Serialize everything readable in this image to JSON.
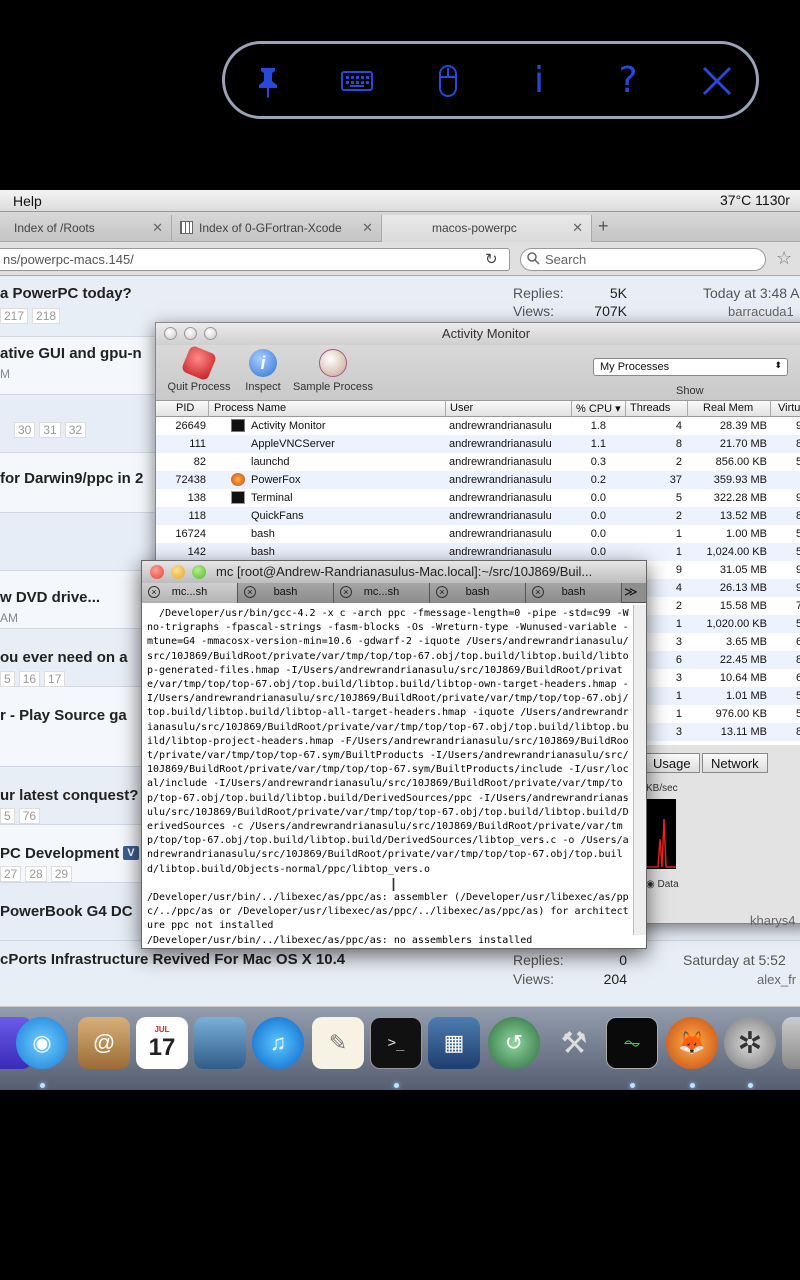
{
  "vnc_toolbar": {
    "info_label": "i",
    "help_label": "?"
  },
  "menubar": {
    "help": "Help",
    "status": "37°C 1130r"
  },
  "browser": {
    "tabs": [
      "Index of /Roots",
      "Index of 0-GFortran-Xcode",
      "macos-powerpc"
    ],
    "url": "ns/powerpc-macs.145/",
    "search_placeholder": "Search"
  },
  "forum": {
    "rows": [
      {
        "title": "a PowerPC today?",
        "pages": [
          "217",
          "218"
        ],
        "replies_label": "Replies:",
        "replies": "5K",
        "views_label": "Views:",
        "views": "707K",
        "date": "Today at 3:48 A",
        "user": "barracuda1"
      },
      {
        "title": "ative GUI and gpu-n",
        "sub": "M"
      },
      {
        "pages": [
          "30",
          "31",
          "32"
        ]
      },
      {
        "title": "for Darwin9/ppc in 2"
      },
      {},
      {
        "title": "w DVD drive...",
        "sub": "AM"
      },
      {
        "title": "ou ever need on a",
        "pages": [
          "5",
          "16",
          "17"
        ]
      },
      {
        "title": "r - Play Source ga"
      },
      {
        "title": "ur latest conquest?",
        "pages": [
          "5",
          "76"
        ]
      },
      {
        "title": "PC Development",
        "badge": "V",
        "pages": [
          "27",
          "28",
          "29"
        ]
      },
      {
        "title": "PowerBook G4 DC",
        "user": "kharys4"
      },
      {
        "title": "cPorts Infrastructure Revived For Mac OS X 10.4",
        "replies_label": "Replies:",
        "replies": "0",
        "views_label": "Views:",
        "views": "204",
        "date": "Saturday at 5:52",
        "user": "alex_fr"
      }
    ]
  },
  "activity_monitor": {
    "title": "Activity Monitor",
    "quit": "Quit Process",
    "inspect": "Inspect",
    "sample": "Sample Process",
    "filter": "My Processes",
    "show": "Show",
    "columns": [
      "PID",
      "Process Name",
      "User",
      "% CPU ▾",
      "Threads",
      "Real Mem",
      "Virtu"
    ],
    "processes": [
      {
        "pid": "26649",
        "name": "Activity Monitor",
        "user": "andrewrandrianasulu",
        "cpu": "1.8",
        "threads": "4",
        "mem": "28.39 MB",
        "v": "9",
        "icon": "am"
      },
      {
        "pid": "111",
        "name": "AppleVNCServer",
        "user": "andrewrandrianasulu",
        "cpu": "1.1",
        "threads": "8",
        "mem": "21.70 MB",
        "v": "8"
      },
      {
        "pid": "82",
        "name": "launchd",
        "user": "andrewrandrianasulu",
        "cpu": "0.3",
        "threads": "2",
        "mem": "856.00 KB",
        "v": "5"
      },
      {
        "pid": "72438",
        "name": "PowerFox",
        "user": "andrewrandrianasulu",
        "cpu": "0.2",
        "threads": "37",
        "mem": "359.93 MB",
        "v": "",
        "icon": "fox"
      },
      {
        "pid": "138",
        "name": "Terminal",
        "user": "andrewrandrianasulu",
        "cpu": "0.0",
        "threads": "5",
        "mem": "322.28 MB",
        "v": "9",
        "icon": "term"
      },
      {
        "pid": "118",
        "name": "QuickFans",
        "user": "andrewrandrianasulu",
        "cpu": "0.0",
        "threads": "2",
        "mem": "13.52 MB",
        "v": "8"
      },
      {
        "pid": "16724",
        "name": "bash",
        "user": "andrewrandrianasulu",
        "cpu": "0.0",
        "threads": "1",
        "mem": "1.00 MB",
        "v": "5"
      },
      {
        "pid": "142",
        "name": "bash",
        "user": "andrewrandrianasulu",
        "cpu": "0.0",
        "threads": "1",
        "mem": "1,024.00 KB",
        "v": "5"
      },
      {
        "threads": "9",
        "mem": "31.05 MB",
        "v": "9"
      },
      {
        "threads": "4",
        "mem": "26.13 MB",
        "v": "9"
      },
      {
        "threads": "2",
        "mem": "15.58 MB",
        "v": "7"
      },
      {
        "threads": "1",
        "mem": "1,020.00 KB",
        "v": "5"
      },
      {
        "threads": "3",
        "mem": "3.65 MB",
        "v": "6"
      },
      {
        "threads": "6",
        "mem": "22.45 MB",
        "v": "8"
      },
      {
        "threads": "3",
        "mem": "10.64 MB",
        "v": "6"
      },
      {
        "threads": "1",
        "mem": "1.01 MB",
        "v": "5"
      },
      {
        "threads": "1",
        "mem": "976.00 KB",
        "v": "5"
      },
      {
        "threads": "3",
        "mem": "13.11 MB",
        "v": "8"
      }
    ],
    "tabs": [
      "Usage",
      "Network"
    ],
    "graph_unit": "KB/sec",
    "data_label": "Data",
    "other_user": "kharys4"
  },
  "terminal": {
    "title": "mc [root@Andrew-Randrianasulus-Mac.local]:~/src/10J869/Buil...",
    "tabs": [
      "mc...sh",
      "bash",
      "mc...sh",
      "bash",
      "bash"
    ],
    "more": "≫",
    "text": "  /Developer/usr/bin/gcc-4.2 -x c -arch ppc -fmessage-length=0 -pipe -std=c99 -Wno-trigraphs -fpascal-strings -fasm-blocks -Os -Wreturn-type -Wunused-variable -mtune=G4 -mmacosx-version-min=10.6 -gdwarf-2 -iquote /Users/andrewrandrianasulu/src/10J869/BuildRoot/private/var/tmp/top/top-67.obj/top.build/libtop.build/libtop-generated-files.hmap -I/Users/andrewrandrianasulu/src/10J869/BuildRoot/private/var/tmp/top/top-67.obj/top.build/libtop.build/libtop-own-target-headers.hmap -I/Users/andrewrandrianasulu/src/10J869/BuildRoot/private/var/tmp/top/top-67.obj/top.build/libtop.build/libtop-all-target-headers.hmap -iquote /Users/andrewrandrianasulu/src/10J869/BuildRoot/private/var/tmp/top/top-67.obj/top.build/libtop.build/libtop-project-headers.hmap -F/Users/andrewrandrianasulu/src/10J869/BuildRoot/private/var/tmp/top/top-67.sym/BuiltProducts -I/Users/andrewrandrianasulu/src/10J869/BuildRoot/private/var/tmp/top/top-67.sym/BuiltProducts/include -I/usr/local/include -I/Users/andrewrandrianasulu/src/10J869/BuildRoot/private/var/tmp/top/top-67.obj/top.build/libtop.build/DerivedSources/ppc -I/Users/andrewrandrianasulu/src/10J869/BuildRoot/private/var/tmp/top/top-67.obj/top.build/libtop.build/DerivedSources -c /Users/andrewrandrianasulu/src/10J869/BuildRoot/private/var/tmp/top/top-67.obj/top.build/libtop.build/DerivedSources/libtop_vers.c -o /Users/andrewrandrianasulu/src/10J869/BuildRoot/private/var/tmp/top/top-67.obj/top.build/libtop.build/Objects-normal/ppc/libtop_vers.o\n\n/Developer/usr/bin/../libexec/as/ppc/as: assembler (/Developer/usr/libexec/as/ppc/../ppc/as or /Developer/usr/libexec/as/ppc/../libexec/as/ppc/as) for architecture ppc not installed\n/Developer/usr/bin/../libexec/as/ppc/as: no assemblers installed"
  },
  "dock": {
    "calendar_day": "17",
    "calendar_month": "JUL"
  },
  "colors": {
    "vnc_icon": "#2748d8",
    "vnc_border": "#9aa3b8",
    "close_red": "#e0443e",
    "min_yellow": "#e2a431",
    "zoom_green": "#58b134"
  }
}
